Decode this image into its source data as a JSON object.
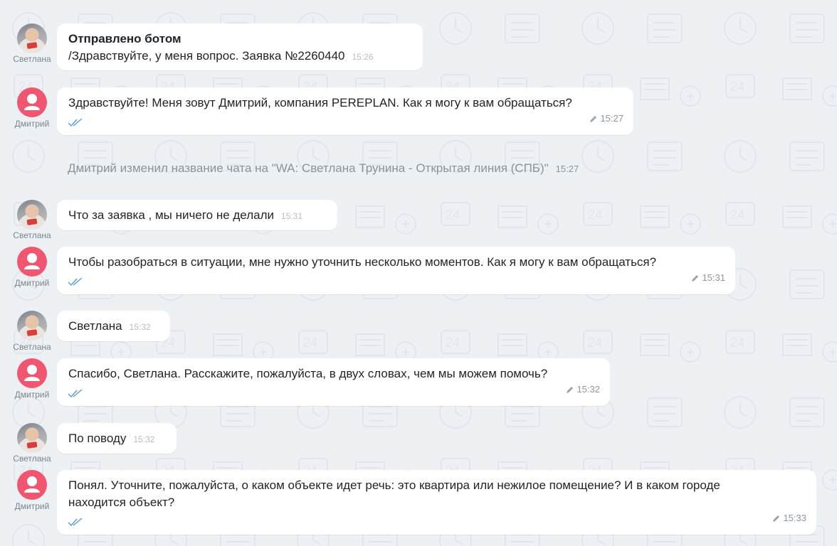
{
  "messages": [
    {
      "sender": "Светлана",
      "title": "Отправлено ботом",
      "text": "/Здравствуйте, у меня вопрос. Заявка №2260440",
      "time": "15:26"
    },
    {
      "sender": "Дмитрий",
      "text": "Здравствуйте! Меня зовут Дмитрий, компания PEREPLAN. Как я могу к вам обращаться?",
      "time": "15:27"
    },
    {
      "sender": "Светлана",
      "text": "Что за заявка , мы ничего не делали",
      "time": "15:31"
    },
    {
      "sender": "Дмитрий",
      "text": "Чтобы разобраться в ситуации, мне нужно уточнить несколько моментов. Как я могу к вам обращаться?",
      "time": "15:31"
    },
    {
      "sender": "Светлана",
      "text": "Светлана",
      "time": "15:32"
    },
    {
      "sender": "Дмитрий",
      "text": "Спасибо, Светлана. Расскажите, пожалуйста, в двух словах, чем мы можем помочь?",
      "time": "15:32"
    },
    {
      "sender": "Светлана",
      "text": "По поводу",
      "time": "15:32"
    },
    {
      "sender": "Дмитрий",
      "text_line1": "Понял. Уточните, пожалуйста, о каком объекте идет речь: это квартира или нежилое помещение? И в каком городе",
      "text_line2": "находится объект?",
      "time": "15:33"
    }
  ],
  "system_message": {
    "text": "Дмитрий изменил название чата на \"WA: Светлана Трунина - Открытая линия (СПБ)\"",
    "time": "15:27"
  },
  "icons": {
    "delivered": "double-check-icon",
    "edited": "pencil-icon",
    "default_avatar": "user-icon"
  },
  "colors": {
    "avatar_pink": "#f0566f",
    "check_blue": "#5b9bd5",
    "background": "#eef1f4"
  }
}
